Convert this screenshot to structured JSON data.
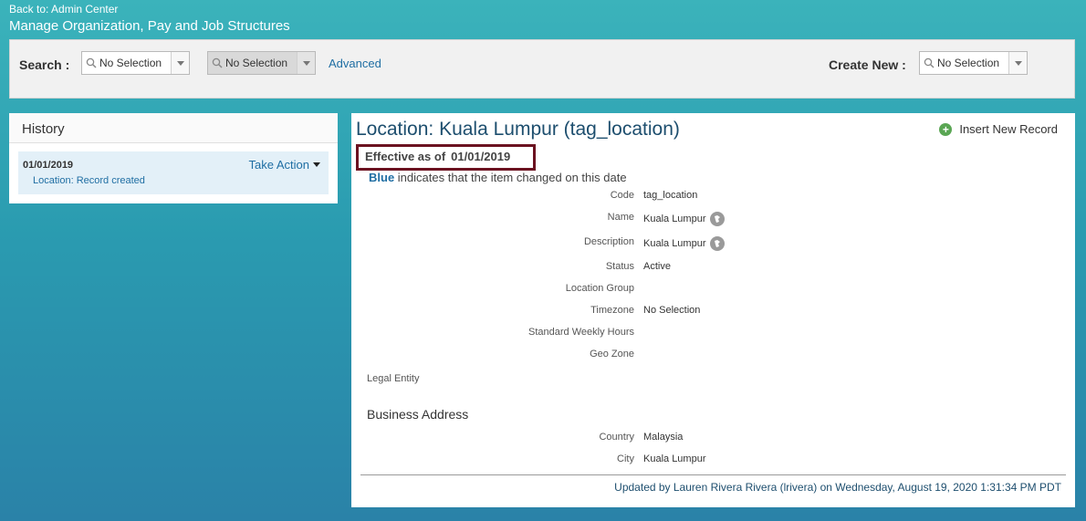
{
  "header": {
    "back_link": "Back to: Admin Center",
    "title": "Manage Organization, Pay and Job Structures"
  },
  "search": {
    "label": "Search :",
    "combo1": "No Selection",
    "combo2": "No Selection",
    "advanced": "Advanced",
    "create_label": "Create New :",
    "create_combo": "No Selection"
  },
  "history": {
    "title": "History",
    "item": {
      "date": "01/01/2019",
      "action": "Take Action",
      "sub": "Location: Record created"
    }
  },
  "detail": {
    "title": "Location: Kuala Lumpur (tag_location)",
    "insert": "Insert New Record",
    "effective_label": "Effective as of",
    "effective_date": "01/01/2019",
    "legend_blue": "Blue",
    "legend_text": "indicates that the item changed on this date",
    "fields": [
      {
        "label": "Code",
        "value": "tag_location"
      },
      {
        "label": "Name",
        "value": "Kuala Lumpur"
      },
      {
        "label": "Description",
        "value": "Kuala Lumpur"
      },
      {
        "label": "Status",
        "value": "Active"
      },
      {
        "label": "Location Group",
        "value": ""
      },
      {
        "label": "Timezone",
        "value": "No Selection"
      },
      {
        "label": "Standard Weekly Hours",
        "value": ""
      },
      {
        "label": "Geo Zone",
        "value": ""
      }
    ],
    "legal_entity": "Legal Entity",
    "business_address": "Business Address",
    "address_fields": [
      {
        "label": "Country",
        "value": "Malaysia"
      },
      {
        "label": "City",
        "value": "Kuala Lumpur"
      }
    ],
    "updated_by": "Updated by Lauren Rivera Rivera (lrivera) on Wednesday, August 19, 2020 1:31:34 PM PDT"
  }
}
